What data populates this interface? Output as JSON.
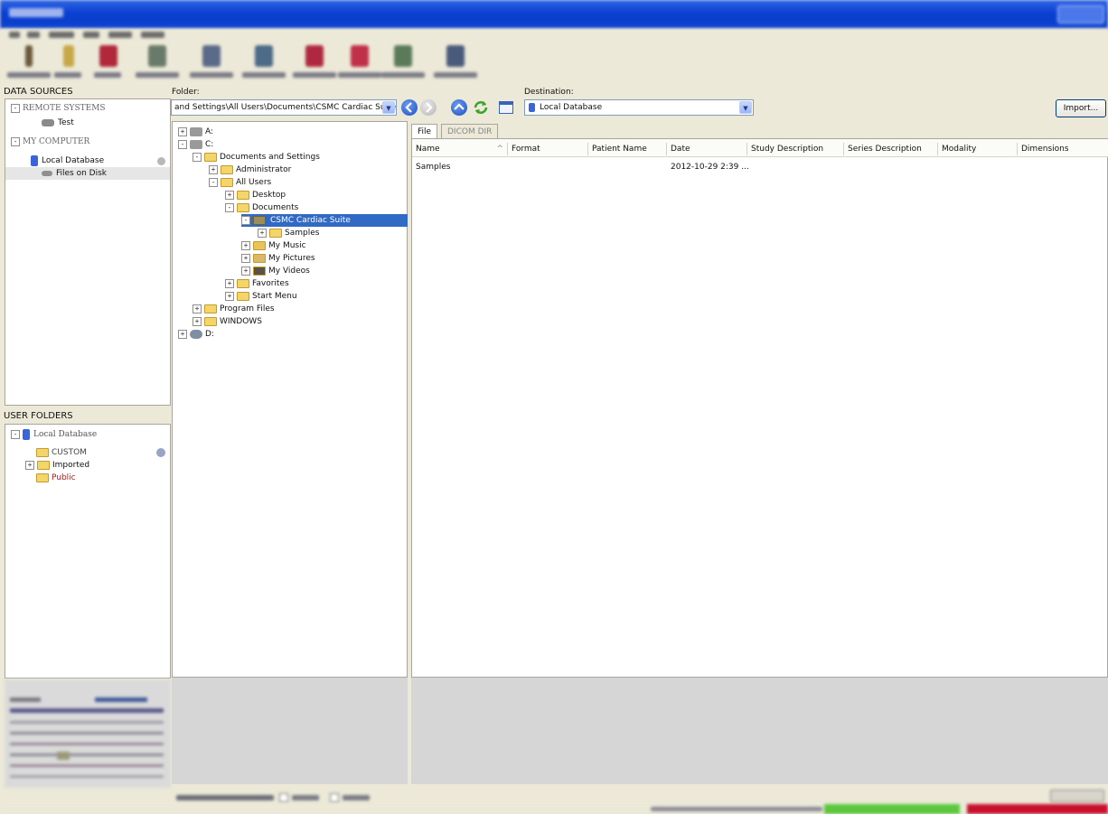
{
  "window": {
    "title": "",
    "accent": "#0a3fd0"
  },
  "menu": {
    "items": [
      "",
      "",
      "",
      "",
      "",
      ""
    ]
  },
  "toolbar": {
    "buttons": [
      {
        "icon": "person-icon",
        "color": "#6b5a3a"
      },
      {
        "icon": "history-icon",
        "color": "#b99a3c"
      },
      {
        "icon": "report-icon",
        "color": "#b0283a"
      },
      {
        "icon": "viewer-icon",
        "color": "#6a7a6a"
      },
      {
        "icon": "viewer-icon",
        "color": "#5a6a88"
      },
      {
        "icon": "viewer-icon",
        "color": "#4d6a86"
      },
      {
        "icon": "report-icon",
        "color": "#b02840"
      },
      {
        "icon": "registry-icon",
        "color": "#5b7a5a"
      },
      {
        "icon": "viewer-icon",
        "color": "#4a5a7a"
      }
    ]
  },
  "data_sources": {
    "header": "DATA SOURCES",
    "remote_systems": "REMOTE SYSTEMS",
    "remote_items": [
      "Test"
    ],
    "my_computer": "MY COMPUTER",
    "computer_items": [
      "Local Database",
      "Files on Disk"
    ]
  },
  "user_folders": {
    "header": "USER FOLDERS",
    "root": "Local Database",
    "items": [
      "CUSTOM",
      "Imported",
      "Public"
    ]
  },
  "folder_bar": {
    "label": "Folder:",
    "path": "and Settings\\All Users\\Documents\\CSMC Cardiac Suite",
    "destination_label": "Destination:",
    "destination": "Local Database",
    "import_label": "Import..."
  },
  "folder_tree": {
    "nodes": [
      {
        "label": "A:",
        "depth": 0,
        "expander": "+",
        "icon": "floppy"
      },
      {
        "label": "C:",
        "depth": 0,
        "expander": "-",
        "icon": "drive"
      },
      {
        "label": "Documents and Settings",
        "depth": 1,
        "expander": "-",
        "icon": "folder"
      },
      {
        "label": "Administrator",
        "depth": 2,
        "expander": "+",
        "icon": "folder"
      },
      {
        "label": "All Users",
        "depth": 2,
        "expander": "-",
        "icon": "folder"
      },
      {
        "label": "Desktop",
        "depth": 3,
        "expander": "+",
        "icon": "folder"
      },
      {
        "label": "Documents",
        "depth": 3,
        "expander": "-",
        "icon": "folder"
      },
      {
        "label": "CSMC Cardiac Suite",
        "depth": 4,
        "expander": "-",
        "icon": "folder",
        "selected": true
      },
      {
        "label": "Samples",
        "depth": 5,
        "expander": "+",
        "icon": "folder"
      },
      {
        "label": "My Music",
        "depth": 4,
        "expander": "+",
        "icon": "music"
      },
      {
        "label": "My Pictures",
        "depth": 4,
        "expander": "+",
        "icon": "pictures"
      },
      {
        "label": "My Videos",
        "depth": 4,
        "expander": "+",
        "icon": "videos"
      },
      {
        "label": "Favorites",
        "depth": 3,
        "expander": "+",
        "icon": "folder"
      },
      {
        "label": "Start Menu",
        "depth": 3,
        "expander": "+",
        "icon": "folder"
      },
      {
        "label": "Program Files",
        "depth": 1,
        "expander": "+",
        "icon": "folder"
      },
      {
        "label": "WINDOWS",
        "depth": 1,
        "expander": "+",
        "icon": "folder"
      },
      {
        "label": "D:",
        "depth": 0,
        "expander": "+",
        "icon": "cd"
      }
    ]
  },
  "file_panel": {
    "tabs": [
      "File",
      "DICOM DIR"
    ],
    "active_tab": "File",
    "columns": [
      "Name",
      "Format",
      "Patient Name",
      "Date",
      "Study Description",
      "Series Description",
      "Modality",
      "Dimensions"
    ],
    "sort_indicator": "^",
    "rows": [
      {
        "Name": "Samples",
        "Format": "",
        "Patient Name": "",
        "Date": "2012-10-29 2:39 ...",
        "Study Description": "",
        "Series Description": "",
        "Modality": "",
        "Dimensions": ""
      }
    ]
  },
  "status": {
    "ok_color": "#59c83c",
    "error_color": "#c8102e"
  }
}
